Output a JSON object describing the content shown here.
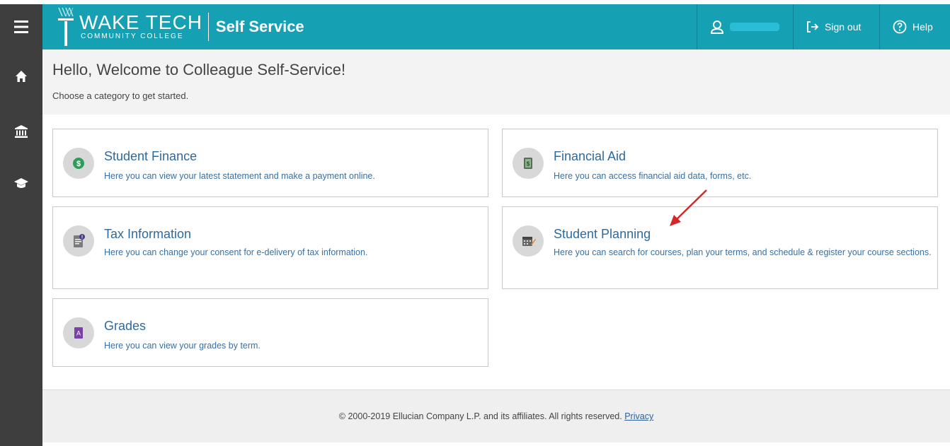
{
  "header": {
    "logo_main": "WAKE TECH",
    "logo_sub": "COMMUNITY COLLEGE",
    "app_name": "Self Service",
    "sign_out_label": "Sign out",
    "help_label": "Help",
    "accent_color": "#15a0b4"
  },
  "welcome": {
    "title": "Hello, Welcome to Colleague Self-Service!",
    "subtitle": "Choose a category to get started."
  },
  "sidebar": {
    "items": [
      {
        "icon": "home-icon"
      },
      {
        "icon": "bank-icon"
      },
      {
        "icon": "graduation-cap-icon"
      }
    ]
  },
  "cards": [
    {
      "title": "Student Finance",
      "desc": "Here you can view your latest statement and make a payment online.",
      "icon": "dollar-icon"
    },
    {
      "title": "Financial Aid",
      "desc": "Here you can access financial aid data, forms, etc.",
      "icon": "money-icon"
    },
    {
      "title": "Tax Information",
      "desc": "Here you can change your consent for e-delivery of tax information.",
      "icon": "tax-document-icon"
    },
    {
      "title": "Student Planning",
      "desc": "Here you can search for courses, plan your terms, and schedule & register your course sections.",
      "icon": "calendar-icon"
    },
    {
      "title": "Grades",
      "desc": "Here you can view your grades by term.",
      "icon": "grade-icon"
    }
  ],
  "footer": {
    "copyright": "© 2000-2019 Ellucian Company L.P. and its affiliates. All rights reserved.",
    "privacy_label": "Privacy"
  }
}
